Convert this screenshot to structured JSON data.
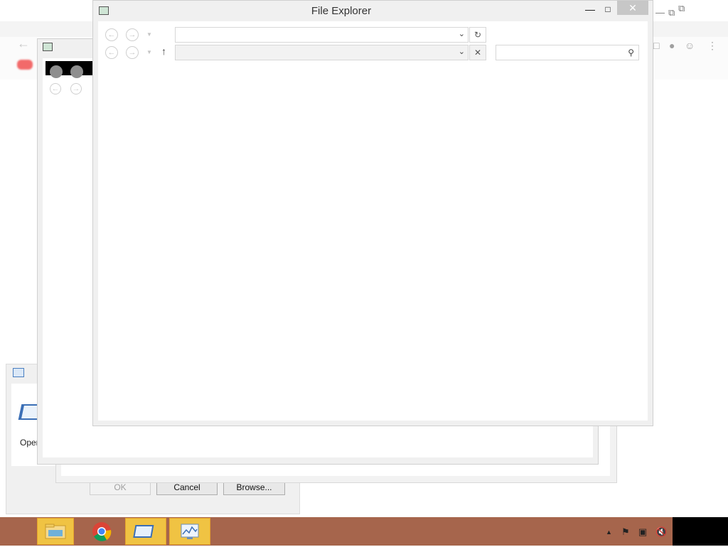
{
  "front_window": {
    "title": "File Explorer",
    "address_placeholder": "",
    "search_placeholder": ""
  },
  "run_dialog": {
    "open_label": "Open",
    "ok_label": "OK",
    "cancel_label": "Cancel",
    "browse_label": "Browse..."
  },
  "taskbar": {
    "items": [
      {
        "name": "file-explorer",
        "active": true
      },
      {
        "name": "chrome",
        "active": false
      },
      {
        "name": "run-dialog",
        "active": true
      },
      {
        "name": "system-monitor",
        "active": true
      }
    ]
  },
  "colors": {
    "taskbar": "#a6654c",
    "taskbar_highlight": "#f0c343"
  }
}
